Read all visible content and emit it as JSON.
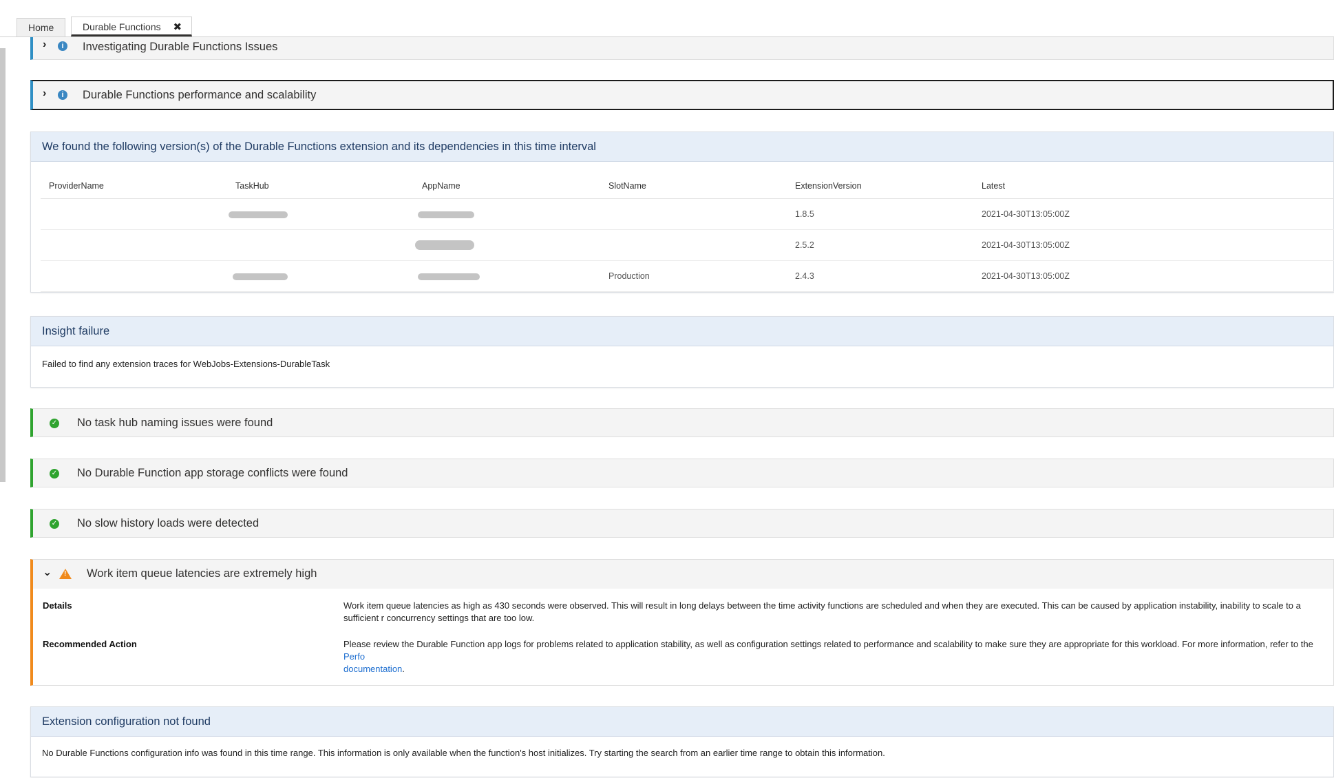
{
  "tabs": [
    {
      "label": "Home"
    },
    {
      "label": "Durable Functions"
    }
  ],
  "tab_close_glyph": "✖",
  "sections": {
    "investigating": {
      "title": "Investigating Durable Functions Issues",
      "icon": "info-icon"
    },
    "performance": {
      "title": "Durable Functions performance and scalability",
      "icon": "info-icon"
    }
  },
  "versions_panel": {
    "title": "We found the following version(s) of the Durable Functions extension and its dependencies in this time interval",
    "columns": [
      "ProviderName",
      "TaskHub",
      "AppName",
      "SlotName",
      "ExtensionVersion",
      "Latest"
    ],
    "rows": [
      {
        "provider": "",
        "taskhub": "",
        "appname": "",
        "slot": "",
        "version": "1.8.5",
        "latest": "2021-04-30T13:05:00Z"
      },
      {
        "provider": "",
        "taskhub": "",
        "appname": "",
        "slot": "",
        "version": "2.5.2",
        "latest": "2021-04-30T13:05:00Z"
      },
      {
        "provider": "",
        "taskhub": "",
        "appname": "",
        "slot": "Production",
        "version": "2.4.3",
        "latest": "2021-04-30T13:05:00Z"
      }
    ]
  },
  "insight_failure": {
    "title": "Insight failure",
    "message": "Failed to find any extension traces for WebJobs-Extensions-DurableTask"
  },
  "checks": [
    {
      "label": "No task hub naming issues were found",
      "icon": "check-circle-icon"
    },
    {
      "label": "No Durable Function app storage conflicts were found",
      "icon": "check-circle-icon"
    },
    {
      "label": "No slow history loads were detected",
      "icon": "check-circle-icon"
    }
  ],
  "warning": {
    "title": "Work item queue latencies are extremely high",
    "details_label": "Details",
    "details_text": "Work item queue latencies as high as 430 seconds were observed. This will result in long delays between the time activity functions are scheduled and when they are executed. This can be caused by application instability, inability to scale to a sufficient r concurrency settings that are too low.",
    "action_label": "Recommended Action",
    "action_text": "Please review the Durable Function app logs for problems related to application stability, as well as configuration settings related to performance and scalability to make sure they are appropriate for this workload. For more information, refer to the ",
    "action_link": "Perfo",
    "action_link2": "documentation",
    "action_tail": "."
  },
  "ext_config": {
    "title": "Extension configuration not found",
    "message": "No Durable Functions configuration info was found in this time range. This information is only available when the function's host initializes. Try starting the search from an earlier time range to obtain this information."
  },
  "colors": {
    "info": "#2f8fc4",
    "success": "#2fa32f",
    "warning": "#f08a1c",
    "panel_head": "#e6eef8"
  }
}
